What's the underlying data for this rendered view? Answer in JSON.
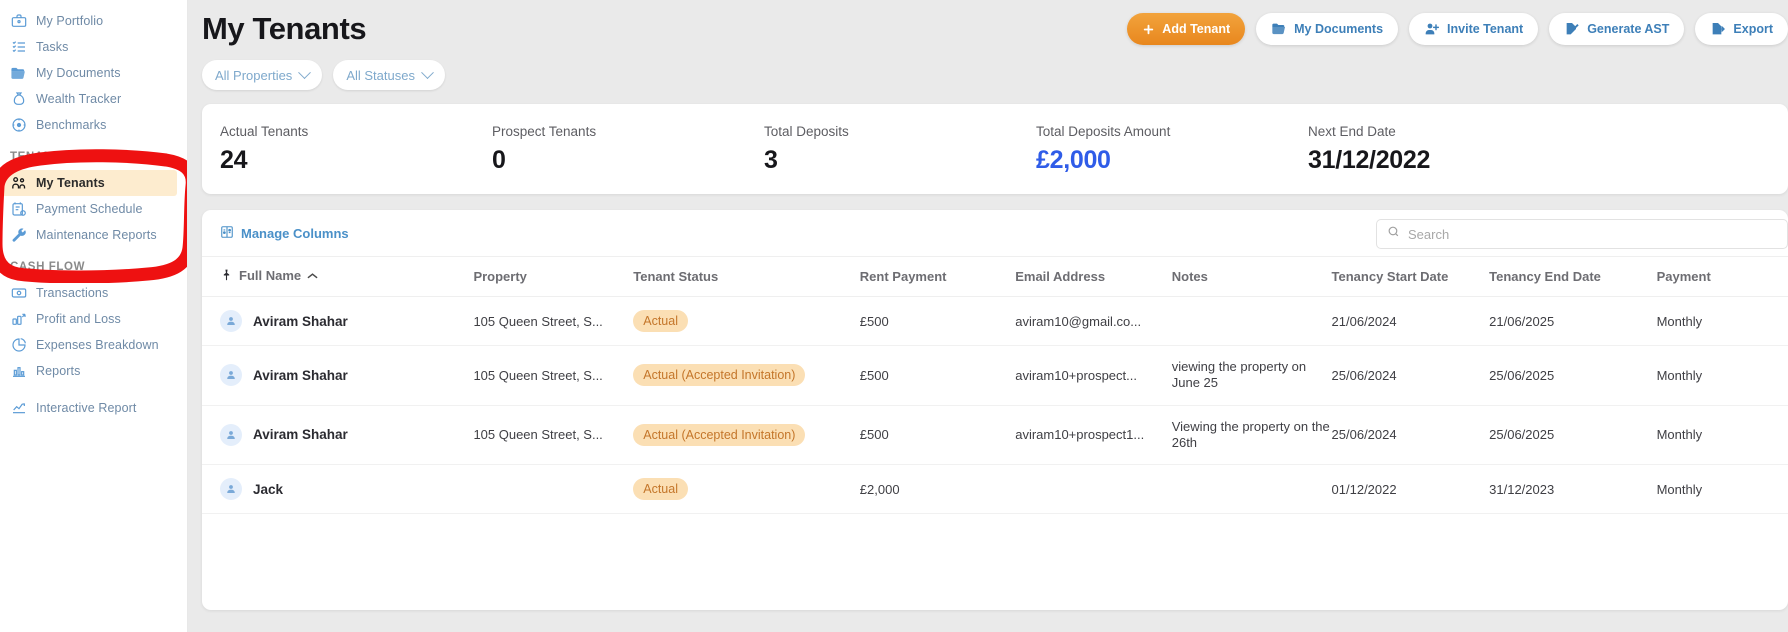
{
  "sidebar": {
    "top_items": [
      {
        "label": "My Portfolio",
        "icon": "briefcase-icon"
      },
      {
        "label": "Tasks",
        "icon": "task-list-icon"
      },
      {
        "label": "My Documents",
        "icon": "folder-icon"
      },
      {
        "label": "Wealth Tracker",
        "icon": "money-bag-icon"
      },
      {
        "label": "Benchmarks",
        "icon": "benchmark-icon"
      }
    ],
    "tenants_section": {
      "title": "TENANTS",
      "items": [
        {
          "label": "My Tenants",
          "icon": "tenants-icon",
          "active": true
        },
        {
          "label": "Payment Schedule",
          "icon": "payment-schedule-icon",
          "active": false
        },
        {
          "label": "Maintenance Reports",
          "icon": "wrench-icon",
          "active": false
        }
      ]
    },
    "cashflow_section": {
      "title": "CASH FLOW",
      "items": [
        {
          "label": "Transactions",
          "icon": "banknote-icon"
        },
        {
          "label": "Profit and Loss",
          "icon": "profit-loss-icon"
        },
        {
          "label": "Expenses Breakdown",
          "icon": "pie-chart-icon"
        },
        {
          "label": "Reports",
          "icon": "bar-chart-icon"
        }
      ]
    },
    "extra_items": [
      {
        "label": "Interactive Report",
        "icon": "line-chart-icon"
      }
    ]
  },
  "header": {
    "title": "My Tenants",
    "buttons": [
      {
        "label": "Add Tenant",
        "icon": "plus-icon",
        "primary": true
      },
      {
        "label": "My Documents",
        "icon": "folder-icon",
        "primary": false
      },
      {
        "label": "Invite Tenant",
        "icon": "user-plus-icon",
        "primary": false
      },
      {
        "label": "Generate AST",
        "icon": "document-pen-icon",
        "primary": false
      },
      {
        "label": "Export",
        "icon": "export-icon",
        "primary": false
      }
    ]
  },
  "filters": [
    {
      "label": "All Properties",
      "name": "all-properties"
    },
    {
      "label": "All Statuses",
      "name": "all-statuses"
    }
  ],
  "stats": [
    {
      "label": "Actual Tenants",
      "value": "24",
      "accent": false
    },
    {
      "label": "Prospect Tenants",
      "value": "0",
      "accent": false
    },
    {
      "label": "Total Deposits",
      "value": "3",
      "accent": false
    },
    {
      "label": "Total Deposits Amount",
      "value": "£2,000",
      "accent": true
    },
    {
      "label": "Next End Date",
      "value": "31/12/2022",
      "accent": false
    }
  ],
  "table": {
    "manage_columns_label": "Manage Columns",
    "search": {
      "placeholder": "Search",
      "value": ""
    },
    "columns": [
      "Full Name",
      "Property",
      "Tenant Status",
      "Rent Payment",
      "Email Address",
      "Notes",
      "Tenancy Start Date",
      "Tenancy End Date",
      "Payment"
    ],
    "sort_column": "Full Name",
    "sort_direction": "asc",
    "rows": [
      {
        "full_name": "Aviram Shahar",
        "property": "105 Queen Street, S...",
        "status": "Actual",
        "rent_payment": "£500",
        "email": "aviram10@gmail.co...",
        "notes": "",
        "start_date": "21/06/2024",
        "end_date": "21/06/2025",
        "payment": "Monthly"
      },
      {
        "full_name": "Aviram Shahar",
        "property": "105 Queen Street, S...",
        "status": "Actual (Accepted Invitation)",
        "rent_payment": "£500",
        "email": "aviram10+prospect...",
        "notes": "viewing the property on June 25",
        "start_date": "25/06/2024",
        "end_date": "25/06/2025",
        "payment": "Monthly"
      },
      {
        "full_name": "Aviram Shahar",
        "property": "105 Queen Street, S...",
        "status": "Actual (Accepted Invitation)",
        "rent_payment": "£500",
        "email": "aviram10+prospect1...",
        "notes": "Viewing the property on the 26th",
        "start_date": "25/06/2024",
        "end_date": "25/06/2025",
        "payment": "Monthly"
      },
      {
        "full_name": "Jack",
        "property": "",
        "status": "Actual",
        "rent_payment": "£2,000",
        "email": "",
        "notes": "",
        "start_date": "01/12/2022",
        "end_date": "31/12/2023",
        "payment": "Monthly"
      }
    ]
  },
  "colors": {
    "primary_orange": "#e8871e",
    "link_blue": "#4a90c8",
    "accent_blue": "#2f5ce8",
    "badge_bg": "#fbdfb4",
    "badge_text": "#c4762a",
    "annotation_red": "#ee1111"
  }
}
